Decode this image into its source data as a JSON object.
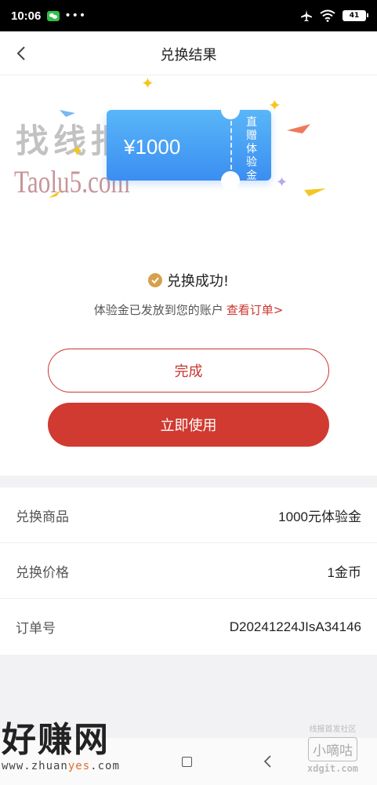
{
  "status_bar": {
    "time": "10:06",
    "dots": "•••",
    "battery": "41",
    "icons": [
      "wechat-icon",
      "airplane-icon",
      "wifi-icon",
      "battery-icon"
    ]
  },
  "header": {
    "title": "兑换结果",
    "back_icon": "chevron-left-icon"
  },
  "watermarks": {
    "top_cn": "找线报",
    "top_url": "Taolu5.com",
    "bottom_left_title": "好赚网",
    "bottom_left_url_prefix": "www.zhuan",
    "bottom_left_url_accent": "yes",
    "bottom_left_url_suffix": ".com",
    "bottom_right_top": "线报首发社区",
    "bottom_right_logo": "小嘀咕",
    "bottom_right_url": "xdgit.com"
  },
  "coupon": {
    "amount": "¥1000",
    "side_label": "直赠体验金"
  },
  "result": {
    "success_text": "兑换成功!",
    "info_text": "体验金已发放到您的账户",
    "view_order_link": "查看订单>"
  },
  "buttons": {
    "done": "完成",
    "use_now": "立即使用"
  },
  "details": [
    {
      "label": "兑换商品",
      "value": "1000元体验金"
    },
    {
      "label": "兑换价格",
      "value": "1金币"
    },
    {
      "label": "订单号",
      "value": "D20241224JIsA34146"
    }
  ],
  "colors": {
    "accent_red": "#d03a30",
    "coupon_blue": "#3b8ef1",
    "check_gold": "#d6a14a"
  }
}
